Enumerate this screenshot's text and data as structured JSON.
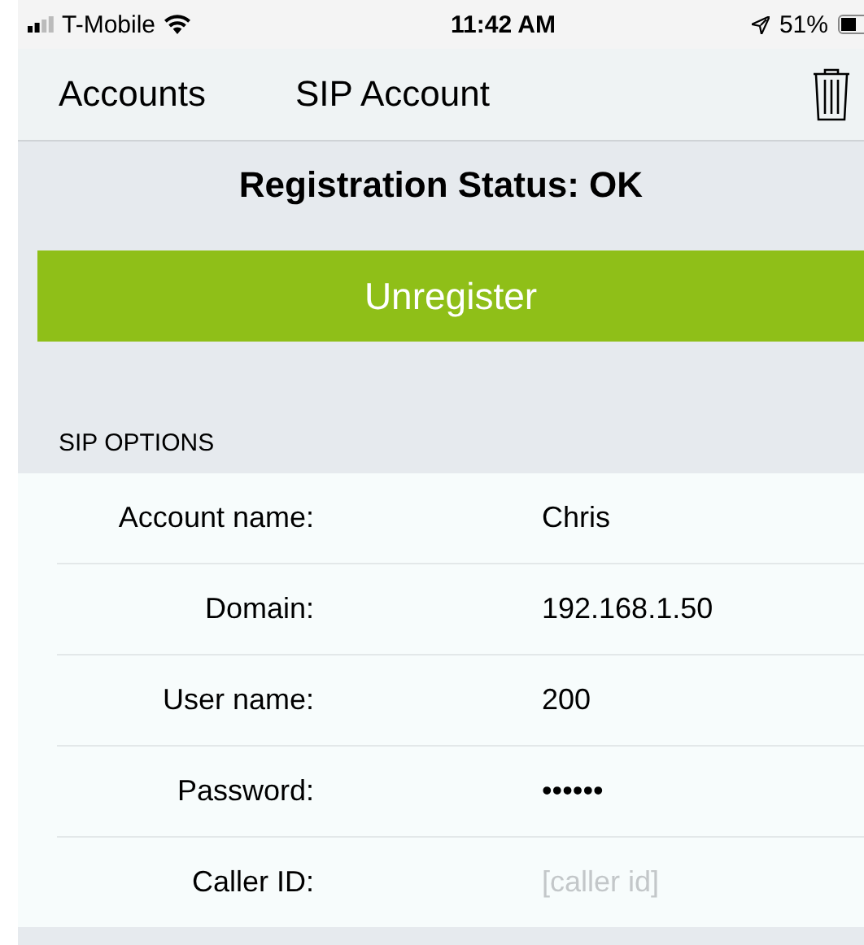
{
  "status_bar": {
    "carrier": "T-Mobile",
    "time": "11:42 AM",
    "battery": "51%"
  },
  "nav_bar": {
    "back": "Accounts",
    "title": "SIP Account"
  },
  "registration": {
    "status": "Registration Status: OK",
    "button": "Unregister"
  },
  "section": {
    "header": "SIP OPTIONS",
    "fields": [
      {
        "label": "Account name:",
        "value": "Chris"
      },
      {
        "label": "Domain:",
        "value": "192.168.1.50"
      },
      {
        "label": "User name:",
        "value": "200"
      },
      {
        "label": "Password:",
        "value": "••••••"
      },
      {
        "label": "Caller ID:",
        "placeholder": "[caller id]"
      }
    ]
  }
}
